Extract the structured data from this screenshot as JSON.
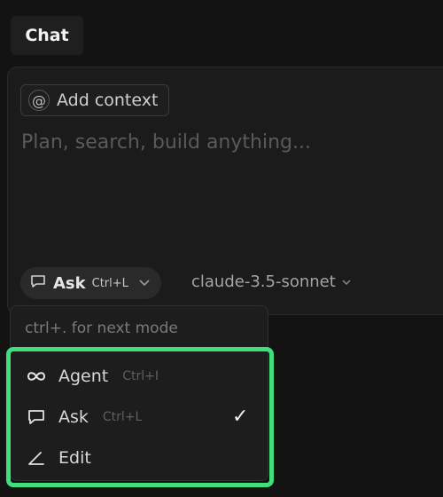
{
  "header": {
    "tab_label": "Chat"
  },
  "composer": {
    "context_chip": {
      "symbol": "@",
      "label": "Add context"
    },
    "placeholder": "Plan, search, build anything...",
    "mode_selector": {
      "label": "Ask",
      "shortcut": "Ctrl+L"
    },
    "model_selector": {
      "label": "claude-3.5-sonnet"
    }
  },
  "mode_menu": {
    "hint": "ctrl+. for next mode",
    "items": [
      {
        "label": "Agent",
        "shortcut": "Ctrl+I",
        "icon": "infinity-icon"
      },
      {
        "label": "Ask",
        "shortcut": "Ctrl+L",
        "icon": "chat-bubble-icon",
        "selected": true
      },
      {
        "label": "Edit",
        "shortcut": "",
        "icon": "edit-angle-icon"
      }
    ],
    "check_symbol": "✓"
  },
  "highlight_color": "#3ee07c"
}
